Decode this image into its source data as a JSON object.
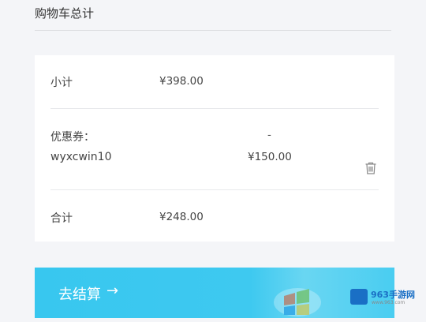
{
  "cart": {
    "title": "购物车总计",
    "subtotal": {
      "label": "小计",
      "value": "¥398.00"
    },
    "coupon": {
      "label": "优惠券：",
      "code": "wyxcwin10",
      "dash": "-",
      "value": "¥150.00"
    },
    "total": {
      "label": "合计",
      "value": "¥248.00"
    },
    "checkout_label": "去结算",
    "checkout_arrow": "→"
  },
  "watermark": {
    "text": "963手游网",
    "sub": "www.963.com"
  },
  "colors": {
    "checkout_bg": "#3ec9f0",
    "page_bg": "#f4f5f8",
    "card_bg": "#ffffff"
  },
  "icons": {
    "delete": "trash-icon",
    "checkout": "arrow-right-icon"
  }
}
